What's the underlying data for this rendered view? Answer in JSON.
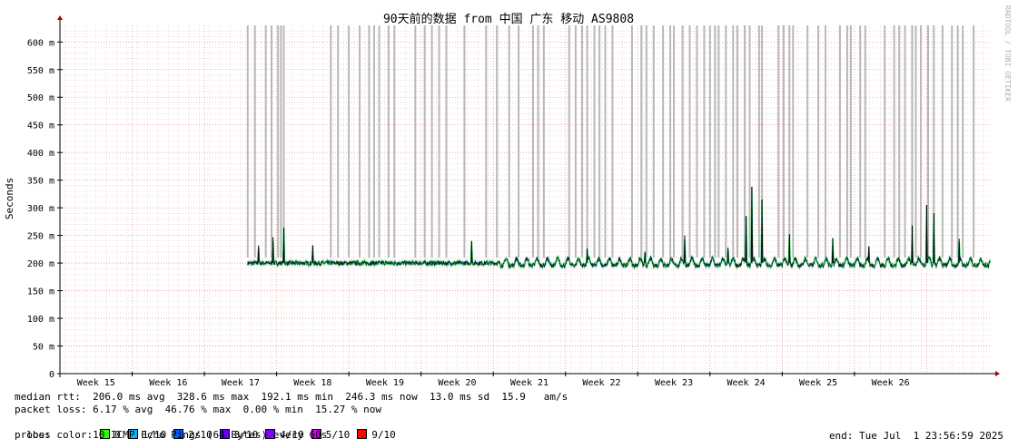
{
  "chart_data": {
    "type": "line",
    "title": "90天前的数据 from 中国 广东 移动 AS9808",
    "ylabel": "Seconds",
    "watermark": "RRDTOOL / TOBI OETIKER",
    "ylim": [
      0,
      0.63
    ],
    "yticks": [
      {
        "v": 0,
        "label": "0"
      },
      {
        "v": 0.05,
        "label": "50 m"
      },
      {
        "v": 0.1,
        "label": "100 m"
      },
      {
        "v": 0.15,
        "label": "150 m"
      },
      {
        "v": 0.2,
        "label": "200 m"
      },
      {
        "v": 0.25,
        "label": "250 m"
      },
      {
        "v": 0.3,
        "label": "300 m"
      },
      {
        "v": 0.35,
        "label": "350 m"
      },
      {
        "v": 0.4,
        "label": "400 m"
      },
      {
        "v": 0.45,
        "label": "450 m"
      },
      {
        "v": 0.5,
        "label": "500 m"
      },
      {
        "v": 0.55,
        "label": "550 m"
      },
      {
        "v": 0.6,
        "label": "600 m"
      }
    ],
    "xlim": [
      14.5,
      27.4
    ],
    "xticks": [
      "Week 15",
      "Week 16",
      "Week 17",
      "Week 18",
      "Week 19",
      "Week 20",
      "Week 21",
      "Week 22",
      "Week 23",
      "Week 24",
      "Week 25",
      "Week 26"
    ],
    "data_start_week": 17.1,
    "baseline_rtt": 0.2,
    "spikes": [
      {
        "x": 17.25,
        "y": 0.232
      },
      {
        "x": 17.45,
        "y": 0.247
      },
      {
        "x": 17.6,
        "y": 0.264
      },
      {
        "x": 18.0,
        "y": 0.232
      },
      {
        "x": 20.2,
        "y": 0.24
      },
      {
        "x": 21.8,
        "y": 0.226
      },
      {
        "x": 22.6,
        "y": 0.22
      },
      {
        "x": 23.15,
        "y": 0.25
      },
      {
        "x": 23.75,
        "y": 0.228
      },
      {
        "x": 24.0,
        "y": 0.285
      },
      {
        "x": 24.08,
        "y": 0.338
      },
      {
        "x": 24.22,
        "y": 0.315
      },
      {
        "x": 24.6,
        "y": 0.252
      },
      {
        "x": 25.2,
        "y": 0.245
      },
      {
        "x": 25.7,
        "y": 0.23
      },
      {
        "x": 26.3,
        "y": 0.268
      },
      {
        "x": 26.5,
        "y": 0.305
      },
      {
        "x": 26.6,
        "y": 0.29
      },
      {
        "x": 26.95,
        "y": 0.244
      }
    ],
    "loss_bands": [
      17.1,
      17.2,
      17.35,
      17.43,
      17.52,
      17.56,
      17.6,
      18.25,
      18.35,
      18.5,
      18.65,
      18.78,
      18.85,
      18.92,
      19.05,
      19.13,
      19.42,
      19.55,
      19.65,
      19.75,
      19.85,
      20.1,
      20.4,
      20.55,
      20.72,
      20.85,
      21.05,
      21.12,
      21.2,
      21.55,
      21.64,
      21.73,
      21.8,
      21.9,
      21.97,
      22.05,
      22.15,
      22.42,
      22.55,
      22.62,
      22.72,
      22.85,
      22.95,
      23.0,
      23.12,
      23.22,
      23.32,
      23.42,
      23.5,
      23.57,
      23.62,
      23.72,
      23.82,
      23.88,
      23.98,
      24.05,
      24.18,
      24.22,
      24.45,
      24.52,
      24.6,
      24.65,
      24.85,
      25.0,
      25.1,
      25.3,
      25.4,
      25.45,
      25.58,
      25.65,
      25.92,
      26.05,
      26.12,
      26.2,
      26.3,
      26.35,
      26.42,
      26.52,
      26.6,
      26.72,
      26.85,
      26.93,
      27.0,
      27.15
    ],
    "legend": {
      "median_rtt": "median rtt:  206.0 ms avg  328.6 ms max  192.1 ms min  246.3 ms now  13.0 ms sd  15.9   am/s",
      "packet_loss": "packet loss: 6.17 % avg  46.76 % max  0.00 % min  15.27 % now",
      "loss_color_label": "loss color:",
      "loss_colors": [
        {
          "label": "0",
          "color": "#26ff00"
        },
        {
          "label": "1/10",
          "color": "#00b8ff"
        },
        {
          "label": "2/10",
          "color": "#0059ff"
        },
        {
          "label": "3/10",
          "color": "#5e00ff"
        },
        {
          "label": "4/10",
          "color": "#7e00ff"
        },
        {
          "label": "5/10",
          "color": "#dd00ff"
        },
        {
          "label": "9/10",
          "color": "#ff0000"
        }
      ],
      "probe": "probe:       10 ICMP Echo Pings (64 Bytes) every 60s",
      "end": "end: Tue Jul  1 23:56:59 2025"
    }
  }
}
